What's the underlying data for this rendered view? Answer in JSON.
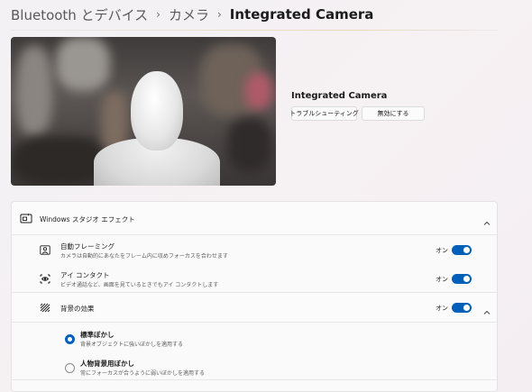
{
  "breadcrumb": {
    "part1": "Bluetooth とデバイス",
    "part2": "カメラ",
    "current": "Integrated Camera",
    "separator": "›"
  },
  "camera": {
    "name": "Integrated Camera",
    "troubleshoot_label": "トラブルシューティング",
    "disable_label": "無効にする"
  },
  "studio_effects": {
    "title": "Windows スタジオ エフェクト",
    "expanded": true,
    "items": [
      {
        "title": "自動フレーミング",
        "description": "カメラは自動的にあなたをフレーム内に収めフォーカスを合わせます",
        "state_label": "オン",
        "on": true,
        "icon": "framing-icon"
      },
      {
        "title": "アイ コンタクト",
        "description": "ビデオ通話など、画面を見ているときでもアイ コンタクトします",
        "state_label": "オン",
        "on": true,
        "icon": "eye-contact-icon"
      },
      {
        "title": "背景の効果",
        "state_label": "オン",
        "on": true,
        "expanded": true,
        "icon": "background-effects-icon"
      }
    ],
    "background_options": [
      {
        "title": "標準ぼかし",
        "description": "背景オブジェクトに強いぼかしを適用する",
        "selected": true
      },
      {
        "title": "人物背景用ぼかし",
        "description": "常にフォーカスが合うように弱いぼかしを適用する",
        "selected": false
      }
    ]
  },
  "colors": {
    "accent": "#005fb8"
  }
}
